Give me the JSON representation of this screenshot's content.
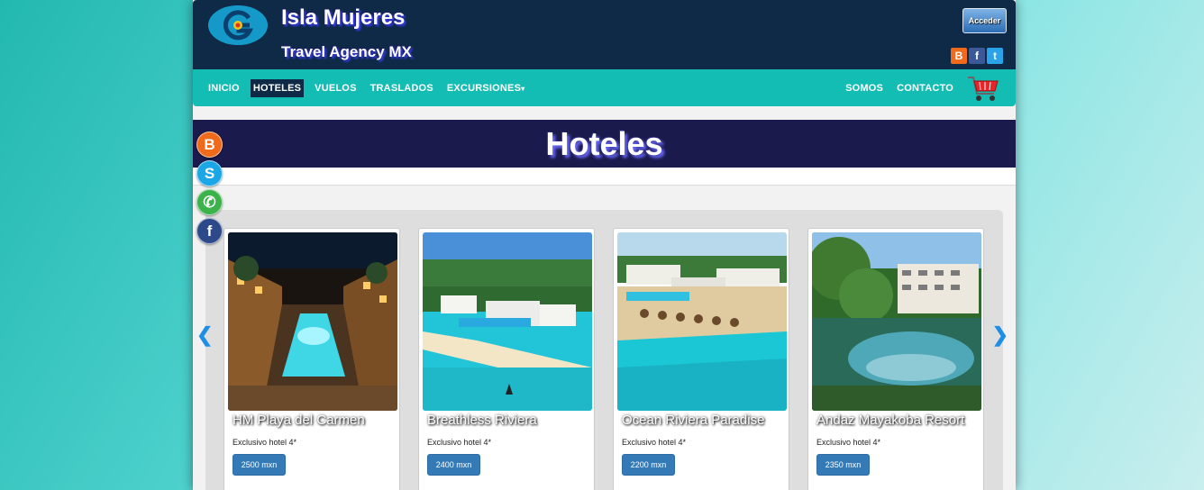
{
  "header": {
    "title": "Isla Mujeres",
    "subtitle": "Travel Agency MX",
    "login_label": "Acceder",
    "social_top": [
      {
        "icon": "blogger-icon",
        "glyph": "B",
        "color": "#f06a1c"
      },
      {
        "icon": "facebook-icon",
        "glyph": "f",
        "color": "#3b5998"
      },
      {
        "icon": "twitter-icon",
        "glyph": "t",
        "color": "#2aa3e8"
      }
    ]
  },
  "nav": {
    "left": [
      {
        "label": "INICIO",
        "active": false
      },
      {
        "label": "HOTELES",
        "active": true
      },
      {
        "label": "VUELOS",
        "active": false
      },
      {
        "label": "TRASLADOS",
        "active": false
      },
      {
        "label": "EXCURSIONES",
        "active": false
      }
    ],
    "right": [
      {
        "label": "SOMOS"
      },
      {
        "label": "CONTACTO"
      }
    ],
    "cart_icon": "shopping-cart-icon"
  },
  "banner": {
    "title": "Hoteles"
  },
  "hotels": [
    {
      "name": "HM Playa del Carmen",
      "desc": "Exclusivo hotel 4*",
      "price": "2500 mxn"
    },
    {
      "name": "Breathless Riviera",
      "desc": "Exclusivo hotel 4*",
      "price": "2400 mxn"
    },
    {
      "name": "Ocean Riviera Paradise",
      "desc": "Exclusivo hotel 4*",
      "price": "2200 mxn"
    },
    {
      "name": "Andaz Mayakoba Resort",
      "desc": "Exclusivo hotel 4*",
      "price": "2350 mxn"
    }
  ],
  "floating_social": [
    {
      "icon": "blogger-icon",
      "glyph": "B",
      "color": "#f06a1c"
    },
    {
      "icon": "skype-icon",
      "glyph": "S",
      "color": "#1ba7e6"
    },
    {
      "icon": "whatsapp-icon",
      "glyph": "✆",
      "color": "#3bb34a"
    },
    {
      "icon": "facebook-icon",
      "glyph": "f",
      "color": "#2c4a8a"
    }
  ],
  "colors": {
    "header_bg": "#0f2a47",
    "nav_bg": "#13bdb3",
    "banner_bg": "#1b1a4d",
    "price_button": "#337ab7"
  }
}
